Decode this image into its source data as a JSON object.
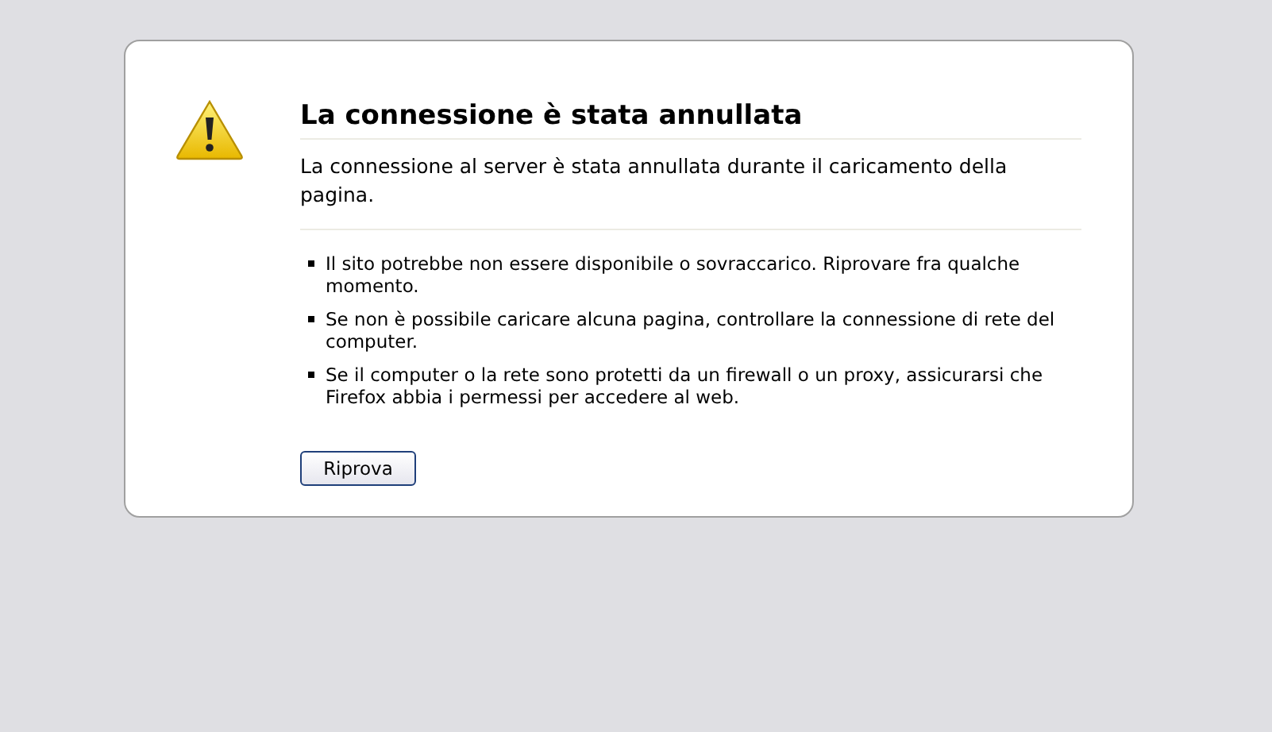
{
  "error_page": {
    "title": "La connessione è stata annullata",
    "description": "La connessione al server è stata annullata durante il caricamento della pagina.",
    "suggestions": [
      "Il sito potrebbe non essere disponibile o sovraccarico. Riprovare fra qualche momento.",
      "Se non è possibile caricare alcuna pagina, controllare la connessione di rete del computer.",
      "Se il computer o la rete sono protetti da un firewall o un proxy, assicurarsi che Firefox abbia i permessi per accedere al web."
    ],
    "button": "Riprova"
  }
}
